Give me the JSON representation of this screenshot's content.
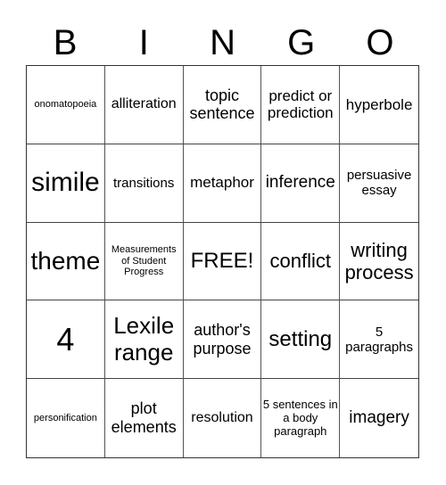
{
  "header": {
    "letters": [
      "B",
      "I",
      "N",
      "G",
      "O"
    ]
  },
  "cells": [
    [
      "onomatopoeia",
      "alliteration",
      "topic sentence",
      "predict or prediction",
      "hyperbole"
    ],
    [
      "simile",
      "transitions",
      "metaphor",
      "inference",
      "persuasive essay"
    ],
    [
      "theme",
      "Measurements of Student Progress",
      "FREE!",
      "conflict",
      "writing process"
    ],
    [
      "4",
      "Lexile range",
      "author's purpose",
      "setting",
      "5 paragraphs"
    ],
    [
      "personification",
      "plot elements",
      "resolution",
      "5 sentences in a body paragraph",
      "imagery"
    ]
  ]
}
